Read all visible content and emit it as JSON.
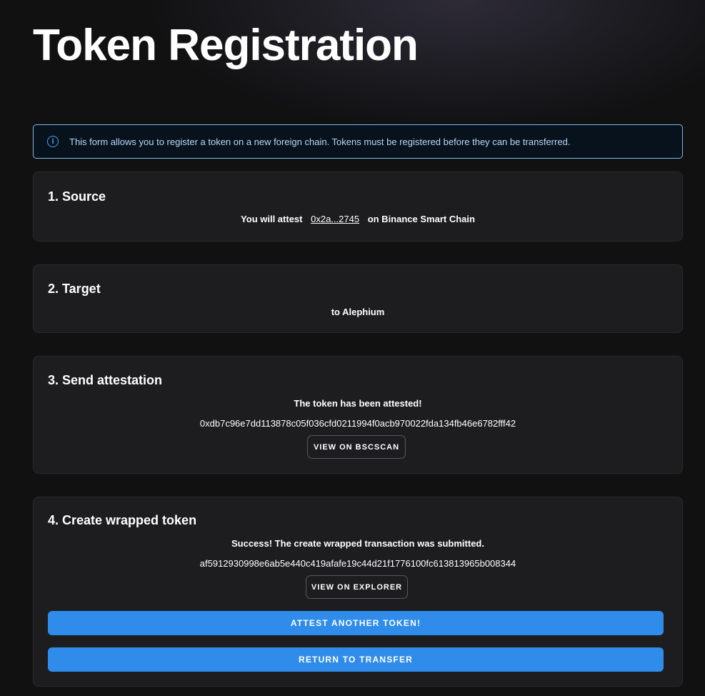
{
  "page": {
    "title": "Token Registration"
  },
  "info": {
    "icon": "info-icon",
    "text": "This form allows you to register a token on a new foreign chain. Tokens must be registered before they can be transferred."
  },
  "steps": {
    "source": {
      "title": "1. Source",
      "prefix": "You will attest",
      "token_address": "0x2a...2745",
      "suffix": "on Binance Smart Chain"
    },
    "target": {
      "title": "2. Target",
      "text": "to Alephium"
    },
    "send_attestation": {
      "title": "3. Send attestation",
      "status": "The token has been attested!",
      "tx_hash": "0xdb7c96e7dd113878c05f036cfd0211994f0acb970022fda134fb46e6782fff42",
      "view_button": "VIEW ON BSCSCAN"
    },
    "create_wrapped": {
      "title": "4. Create wrapped token",
      "status": "Success! The create wrapped transaction was submitted.",
      "tx_hash": "af5912930998e6ab5e440c419afafe19c44d21f1776100fc613813965b008344",
      "view_button": "VIEW ON EXPLORER",
      "attest_another_button": "ATTEST ANOTHER TOKEN!",
      "return_button": "RETURN TO TRANSFER"
    }
  },
  "colors": {
    "background": "#111112",
    "card": "#1d1d1f",
    "accent": "#2f8ceb",
    "info_border": "#7fb8e8"
  }
}
